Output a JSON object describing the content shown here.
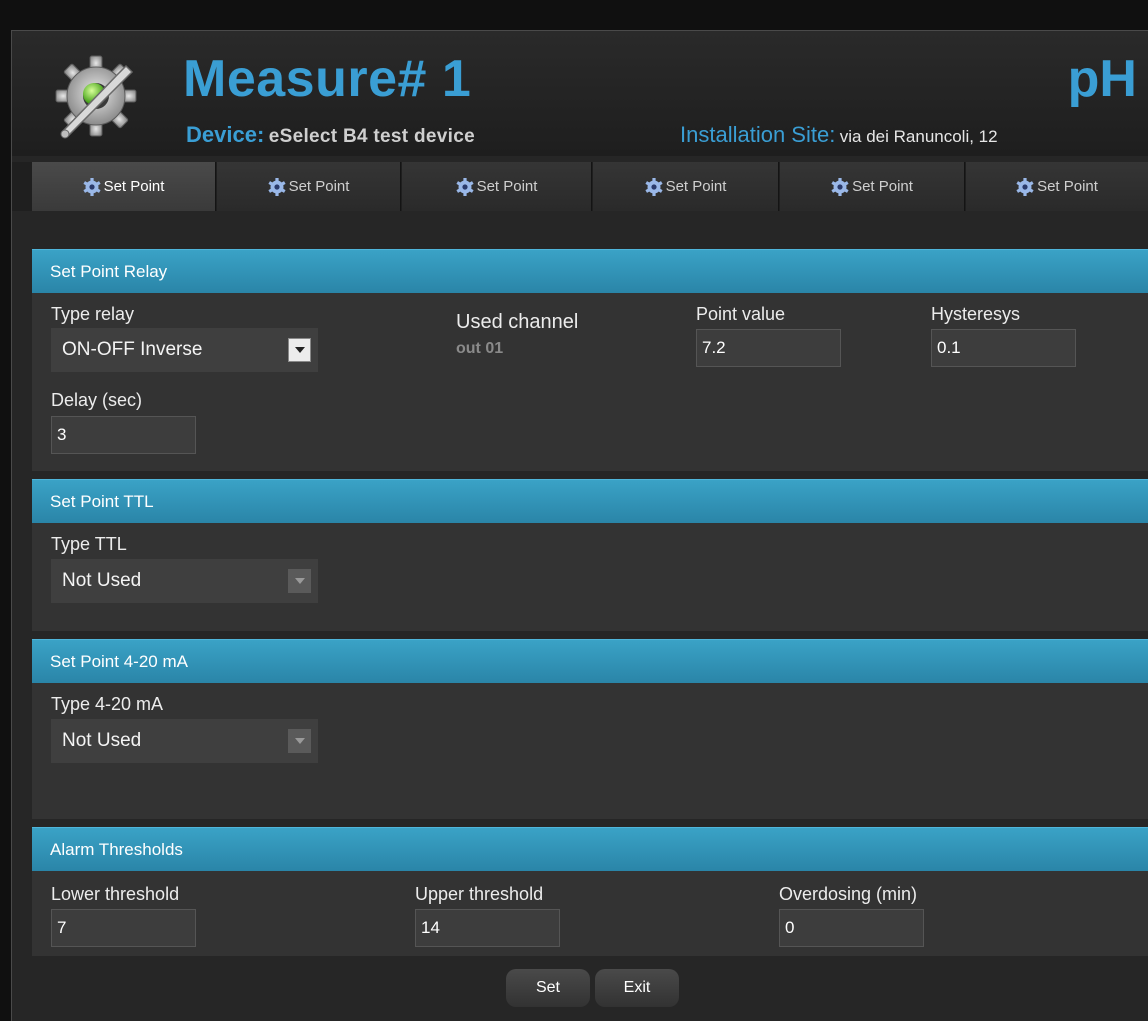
{
  "header": {
    "title": "Measure# 1",
    "device_label": "Device:",
    "device_value": "eSelect B4 test device",
    "unit": "pH",
    "site_label": "Installation Site:",
    "site_value": "via dei Ranuncoli, 12",
    "icon": "settings-gear-wrench-icon"
  },
  "tabs": [
    {
      "label": "Set Point",
      "active": true,
      "icon": "gear-icon"
    },
    {
      "label": "Set Point",
      "icon": "gear-icon"
    },
    {
      "label": "Set Point",
      "icon": "gear-icon"
    },
    {
      "label": "Set Point",
      "icon": "gear-icon"
    },
    {
      "label": "Set Point",
      "icon": "gear-icon"
    },
    {
      "label": "Set Point",
      "icon": "gear-icon"
    }
  ],
  "relay": {
    "title": "Set Point Relay",
    "type_label": "Type relay",
    "type_value": "ON-OFF Inverse",
    "channel_label": "Used channel",
    "channel_value": "out 01",
    "point_label": "Point value",
    "point_value": "7.2",
    "hyst_label": "Hysteresys",
    "hyst_value": "0.1",
    "delay_label": "Delay (sec)",
    "delay_value": "3"
  },
  "ttl": {
    "title": "Set Point TTL",
    "type_label": "Type TTL",
    "type_value": "Not Used"
  },
  "ma": {
    "title": "Set Point 4-20 mA",
    "type_label": "Type 4-20 mA",
    "type_value": "Not Used"
  },
  "alarm": {
    "title": "Alarm Thresholds",
    "lower_label": "Lower threshold",
    "lower_value": "7",
    "upper_label": "Upper threshold",
    "upper_value": "14",
    "over_label": "Overdosing (min)",
    "over_value": "0"
  },
  "buttons": {
    "set": "Set",
    "exit": "Exit"
  },
  "colors": {
    "accent": "#3a9ed4",
    "section_bar": "#2f8fb4",
    "background": "#262626"
  }
}
